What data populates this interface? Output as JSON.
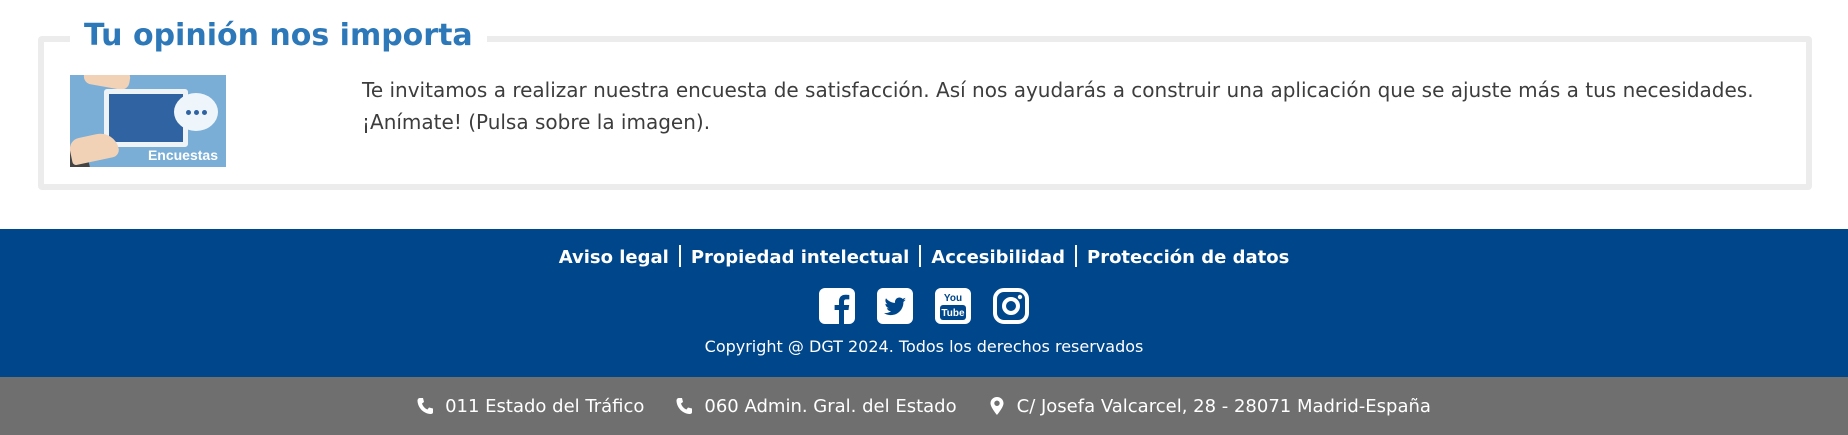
{
  "survey": {
    "title": "Tu opinión nos importa",
    "image_caption": "Encuestas",
    "text_line1": "Te invitamos a realizar nuestra encuesta de satisfacción. Así nos ayudarás a construir una aplicación que se ajuste más a tus necesidades.",
    "text_line2": "¡Anímate! (Pulsa sobre la imagen)."
  },
  "footer": {
    "links": [
      {
        "label": "Aviso legal"
      },
      {
        "label": "Propiedad intelectual"
      },
      {
        "label": "Accesibilidad"
      },
      {
        "label": "Protección de datos"
      }
    ],
    "social": [
      {
        "icon": "facebook-icon"
      },
      {
        "icon": "twitter-icon"
      },
      {
        "icon": "youtube-icon",
        "text": "You Tube"
      },
      {
        "icon": "instagram-icon"
      }
    ],
    "copyright": "Copyright @ DGT 2024. Todos los derechos reservados"
  },
  "contact": {
    "items": [
      {
        "icon": "phone-icon",
        "label": "011 Estado del Tráfico"
      },
      {
        "icon": "phone-icon",
        "label": "060 Admin. Gral. del Estado"
      },
      {
        "icon": "map-marker-icon",
        "label": "C/ Josefa Valcarcel, 28 - 28071 Madrid-España"
      }
    ]
  },
  "colors": {
    "title_blue": "#2d78b8",
    "footer_blue": "#00468b",
    "contact_gray": "#6f6f6f"
  }
}
